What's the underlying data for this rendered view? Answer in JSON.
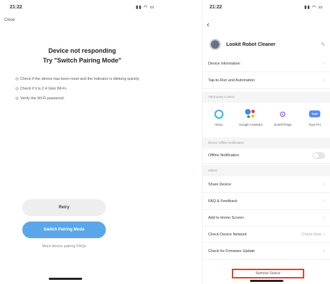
{
  "left": {
    "status_time": "21:22",
    "status_icons": "▮▮ ◠ ▭",
    "close_label": "Close",
    "title_line1": "Device not responding",
    "title_line2": "Try \"Switch Pairing Mode\"",
    "tips": [
      "Check if the device has been reset and the indicator is blinking quickly.",
      "Check if it is 2.4 GHz Wi-Fi.",
      "Verify the Wi-Fi password."
    ],
    "retry_label": "Retry",
    "switch_label": "Switch Pairing Mode",
    "faq_label": "More device pairing FAQs"
  },
  "right": {
    "status_time": "21:22",
    "status_icons": "▮▮ ◠ ▭",
    "device_name": "Lookit Robot Cleaner",
    "rows_top": [
      {
        "label": "Device Information"
      },
      {
        "label": "Tap-to-Run and Automation"
      }
    ],
    "section_services": "Third-party Control",
    "services": [
      {
        "label": "Alexa",
        "icon": "alexa-icon"
      },
      {
        "label": "Google Assistant",
        "icon": "google-assistant-icon"
      },
      {
        "label": "SmartThings",
        "icon": "smartthings-icon"
      },
      {
        "label": "Tuya Pro",
        "icon": "tuya-pro-icon"
      }
    ],
    "section_offline": "Device Offline Notification",
    "offline_label": "Offline Notification",
    "section_others": "Others",
    "rows_others": [
      {
        "label": "Share Device",
        "value": ""
      },
      {
        "label": "FAQ & Feedback",
        "value": ""
      },
      {
        "label": "Add to Home Screen",
        "value": ""
      },
      {
        "label": "Check Device Network",
        "value": "Check Now"
      },
      {
        "label": "Check for Firmware Update",
        "value": ""
      }
    ],
    "remove_label": "Remove Device",
    "highlight_color": "#e2402a"
  }
}
